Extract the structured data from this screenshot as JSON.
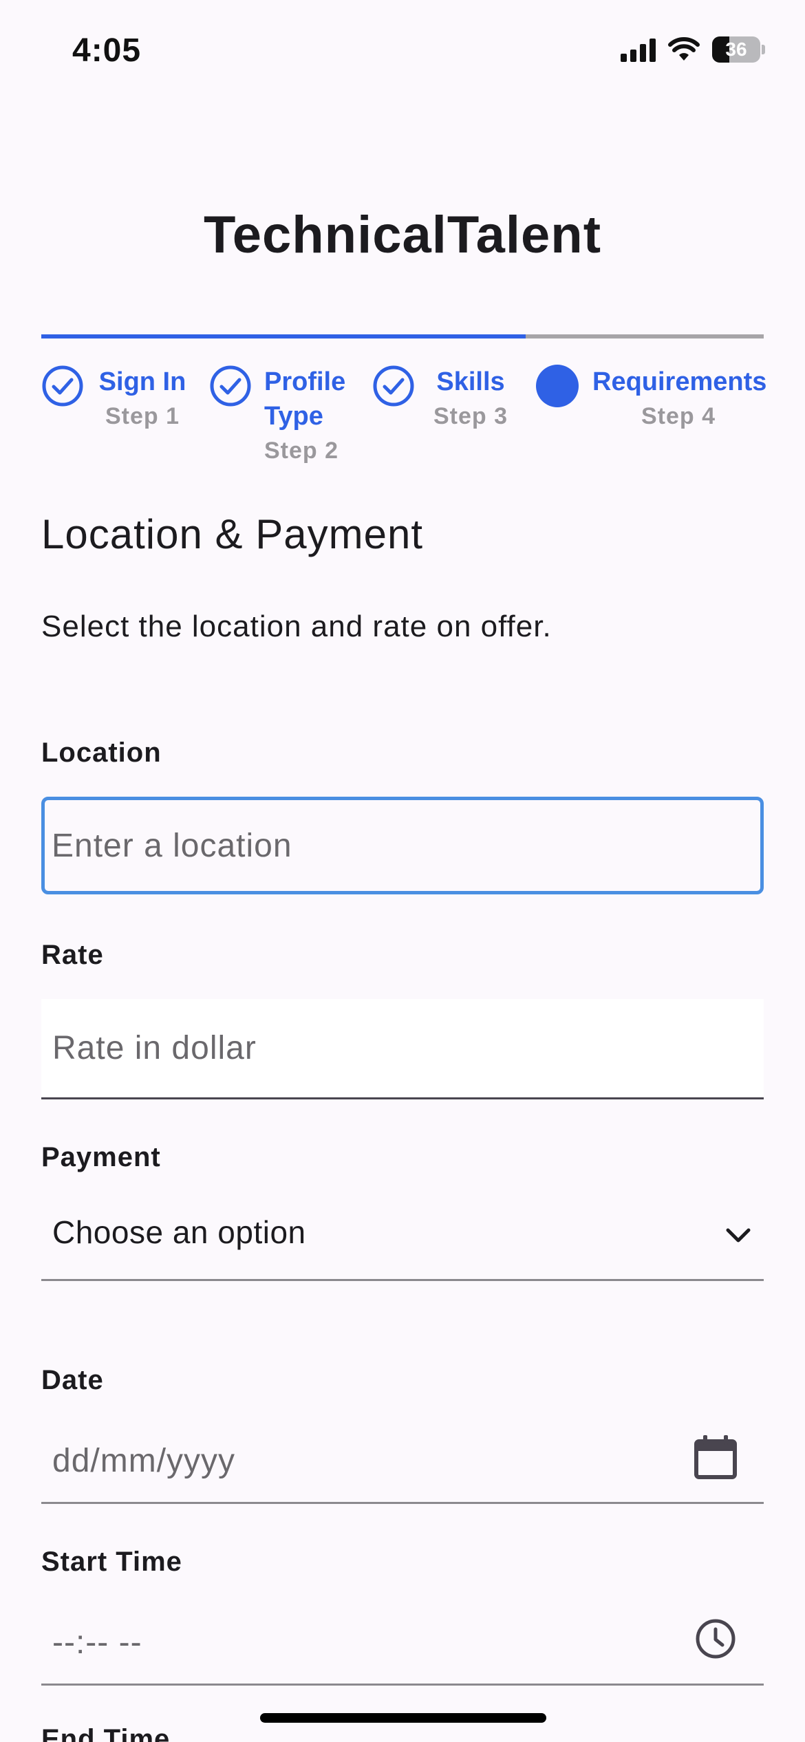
{
  "status_bar": {
    "time": "4:05",
    "battery": "36",
    "battery_level": 0.36
  },
  "app": {
    "title": "TechnicalTalent"
  },
  "stepper": {
    "progress": 0.67,
    "steps": [
      {
        "label": "Sign In",
        "sub": "Step 1",
        "state": "complete"
      },
      {
        "label": "Profile\nType",
        "sub": "Step 2",
        "state": "complete"
      },
      {
        "label": "Skills",
        "sub": "Step 3",
        "state": "complete"
      },
      {
        "label": "Requirements",
        "sub": "Step 4",
        "state": "active"
      }
    ]
  },
  "section": {
    "title": "Location & Payment",
    "description": "Select the location and rate on offer."
  },
  "fields": {
    "location": {
      "label": "Location",
      "placeholder": "Enter a location",
      "value": ""
    },
    "rate": {
      "label": "Rate",
      "placeholder": "Rate in dollar",
      "value": ""
    },
    "payment": {
      "label": "Payment",
      "selected": "Choose an option"
    },
    "date": {
      "label": "Date",
      "value": "dd/mm/yyyy"
    },
    "start_time": {
      "label": "Start Time",
      "value": "--:-- --"
    },
    "end_time": {
      "label": "End Time"
    }
  },
  "colors": {
    "accent": "#2f61e5",
    "focus_border": "#4a8fe2",
    "background": "#fcf9fd"
  }
}
